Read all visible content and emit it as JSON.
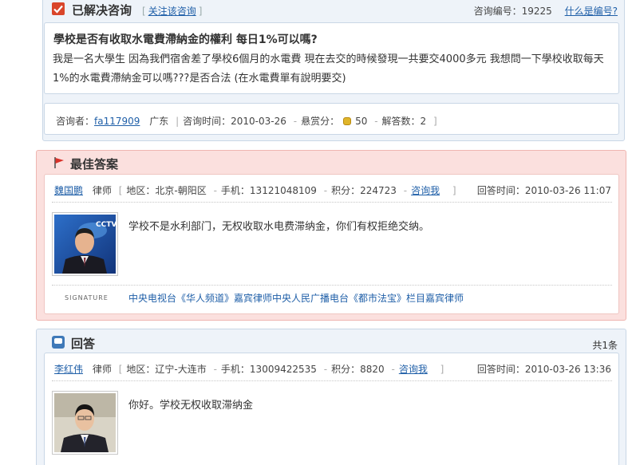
{
  "question": {
    "status": "已解决咨询",
    "follow_link": "关注该咨询",
    "id_label": "咨询编号：",
    "id_value": "19225",
    "id_help": "什么是编号?",
    "subject": "學校是否有收取水電費滯納金的權利 每日1%可以嗎?",
    "body": "我是一名大學生 因為我們宿舍差了學校6個月的水電費 現在去交的時候發現一共要交4000多元 我想問一下學校收取每天1%的水電費滯納金可以嗎???是否合法 (在水電費單有說明要交)",
    "meta": {
      "asker_label": "咨询者：",
      "asker": "fa117909",
      "region": "广东",
      "time_label": "咨询时间：",
      "time": "2010-03-26",
      "reward_label": "悬赏分：",
      "reward": "50",
      "answers_label": "解答数：",
      "answers": "2"
    }
  },
  "best_answer": {
    "title": "最佳答案",
    "lawyer_name": "魏国鹏",
    "lawyer_title": "律师",
    "region_label": "地区：",
    "region": "北京-朝阳区",
    "phone_label": "手机：",
    "phone": "13121048109",
    "points_label": "积分：",
    "points": "224723",
    "consult_link": "咨询我",
    "time_label": "回答时间：",
    "time": "2010-03-26 11:07",
    "text": "学校不是水利部门，无权收取水电费滞纳金，你们有权拒绝交纳。",
    "signature_label": "SIGNATURE",
    "signature": "中央电视台《华人频道》嘉宾律师中央人民广播电台《都市法宝》栏目嘉宾律师",
    "avatar_logo": "CCTV"
  },
  "answers": {
    "title": "回答",
    "count": "共1条",
    "items": [
      {
        "lawyer_name": "李红伟",
        "lawyer_title": "律师",
        "region_label": "地区：",
        "region": "辽宁-大连市",
        "phone_label": "手机：",
        "phone": "13009422535",
        "points_label": "积分：",
        "points": "8820",
        "consult_link": "咨询我",
        "time_label": "回答时间：",
        "time": "2010-03-26 13:36",
        "text": "你好。学校无权收取滞纳金"
      }
    ]
  },
  "colors": {
    "link": "#1f5fa8",
    "best_bg": "#fbe0de",
    "panel_bg": "#eef3f9",
    "check_red": "#d9452a"
  }
}
